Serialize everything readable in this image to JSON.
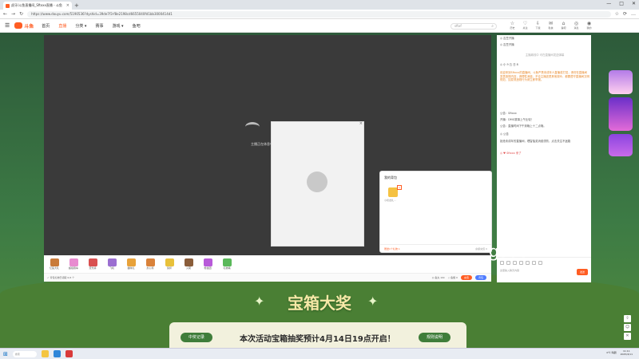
{
  "browser": {
    "tab_title": "虎牙/斗鱼直播间_Sftxxx直播 - 斗鱼",
    "new_tab": "+",
    "window_controls": [
      "—",
      "□",
      "✕"
    ],
    "url": "https://www.douyu.com/5190536?dyshid=39de7f3-f8e2198cd6655040fd1bb3000414d1",
    "nav": [
      "←",
      "→",
      "↻"
    ],
    "icons": [
      "☆",
      "⟳",
      "…"
    ]
  },
  "site": {
    "menu_icon": "☰",
    "logo_text": "斗鱼",
    "nav": [
      {
        "label": "首页",
        "active": false
      },
      {
        "label": "直播",
        "active": true
      },
      {
        "label": "分类 ▾",
        "active": false
      },
      {
        "label": "赛事",
        "active": false
      },
      {
        "label": "游戏 ▾",
        "active": false
      },
      {
        "label": "鱼吧",
        "active": false
      }
    ],
    "search_placeholder": "sftxf",
    "search_icon": "⌕",
    "top_icons": [
      {
        "glyph": "☆",
        "label": "历史"
      },
      {
        "glyph": "♡",
        "label": "关注"
      },
      {
        "glyph": "⇩",
        "label": "下载"
      },
      {
        "glyph": "✉",
        "label": "私信"
      },
      {
        "glyph": "⌂",
        "label": "鱼吧"
      },
      {
        "glyph": "◎",
        "label": "消息"
      },
      {
        "glyph": "◉",
        "label": "我的"
      }
    ]
  },
  "video": {
    "loading_text": "主播正在休息中",
    "popup_close": "×",
    "gift_popup": {
      "title": "我的背包",
      "badge": "1",
      "item_name": "小奶龙礼...",
      "footer_left": "赠送1个礼物 1",
      "footer_right": "余额充值 0"
    }
  },
  "gifts": [
    {
      "label": "亿鱼大礼",
      "color": "#c97b3a"
    },
    {
      "label": "超级跑车",
      "color": "#e88bd0"
    },
    {
      "label": "荧光棒",
      "color": "#d95050"
    },
    {
      "label": "飞机",
      "color": "#9b6fd1"
    },
    {
      "label": "猫咪礼",
      "color": "#e8a23a"
    },
    {
      "label": "办公椅",
      "color": "#d9823a"
    },
    {
      "label": "奖杯",
      "color": "#e8c13a"
    },
    {
      "label": "火箭",
      "color": "#8a5d3a"
    },
    {
      "label": "粉丝团",
      "color": "#b85ad9"
    },
    {
      "label": "礼物墙",
      "color": "#5ab85a"
    }
  ],
  "action_bar": {
    "left": "✓ 背包礼物已领取 0/4 个",
    "fish_balls": "◎ 鱼丸 10k",
    "fish_wing": "◇ 鱼翅 0",
    "recharge": "充值",
    "gift_btn": "背包"
  },
  "chat": {
    "lines": [
      {
        "text": "◎ 吉豆开播",
        "orange": false
      },
      {
        "text": "◎ 吉豆开播",
        "orange": false
      },
      {
        "text": "主播离线中 可在直播间发送弹幕",
        "orange": false
      },
      {
        "text": "◎ 小 9 丘 日 8",
        "orange": false
      },
      {
        "text": "欢迎来到Sftxxx的直播间，斗鱼严禁未成年人直播或打赏，请勿在直播间发表违规内容，请理性消费。不论主播还是其他观众，都要遵守直播间文明规范，如发现违规行为请立即举报。",
        "orange": true
      },
      {
        "text": "公告：Sftxxx",
        "orange": false
      },
      {
        "text": "开播：DMG赛事上午比较！",
        "orange": false
      },
      {
        "text": "公告：直播时间下午到晚上十二点哦。",
        "orange": false
      },
      {
        "text": "◎ 公告",
        "orange": false
      },
      {
        "text": "拒绝未成年的直播间，理智抽奖消费谨防，点击关注不迷路",
        "orange": false
      },
      {
        "text": "◎ ♥ Sftxxx 来了",
        "orange": false
      }
    ],
    "input_placeholder": "这里输入聊天内容",
    "send": "发送"
  },
  "watermark": "g599",
  "banner": {
    "title": "宝箱大奖",
    "star_left": "✦",
    "star_right": "✦",
    "record_btn": "中奖记录",
    "message": "本次活动宝箱抽奖预计4月14日19点开启！",
    "rules_btn": "规则说明"
  },
  "sidebar_buttons": [
    "⇧",
    "☺",
    "✕"
  ],
  "taskbar": {
    "start": "⊞",
    "search": "搜索",
    "weather": "0℃ 晴朗",
    "time": "11:11",
    "date": "2025/4/11"
  }
}
